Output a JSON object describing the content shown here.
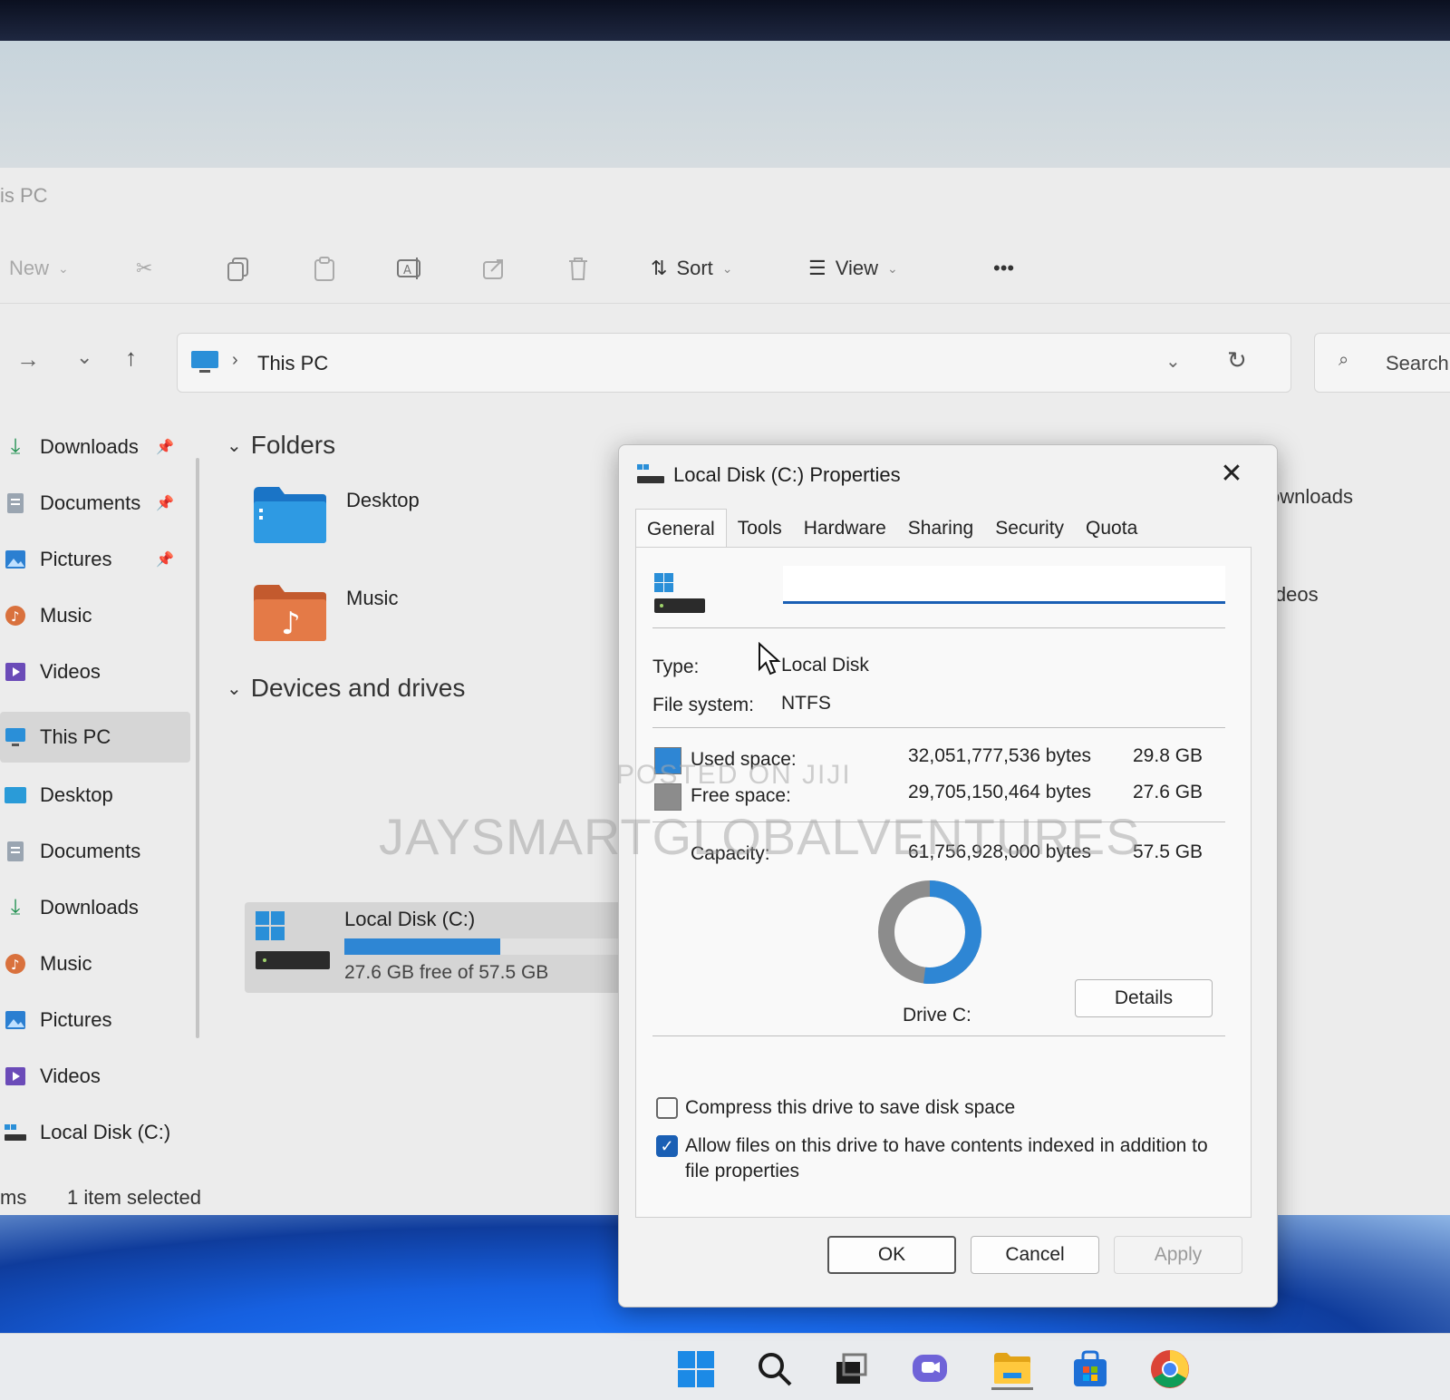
{
  "window": {
    "title": "is PC"
  },
  "commandbar": {
    "new_label": "New",
    "sort_label": "Sort",
    "view_label": "View",
    "more_label": "•••"
  },
  "address": {
    "path": "This PC",
    "search_placeholder": "Search"
  },
  "sidebar": {
    "items": [
      {
        "label": "Downloads",
        "icon": "download-icon",
        "pinned": true
      },
      {
        "label": "Documents",
        "icon": "document-icon",
        "pinned": true
      },
      {
        "label": "Pictures",
        "icon": "pictures-icon",
        "pinned": true
      },
      {
        "label": "Music",
        "icon": "music-icon"
      },
      {
        "label": "Videos",
        "icon": "videos-icon"
      },
      {
        "label": "This PC",
        "icon": "computer-icon",
        "selected": true
      },
      {
        "label": "Desktop",
        "icon": "desktop-icon"
      },
      {
        "label": "Documents",
        "icon": "document-icon"
      },
      {
        "label": "Downloads",
        "icon": "download-icon"
      },
      {
        "label": "Music",
        "icon": "music-icon"
      },
      {
        "label": "Pictures",
        "icon": "pictures-icon"
      },
      {
        "label": "Videos",
        "icon": "videos-icon"
      },
      {
        "label": "Local Disk (C:)",
        "icon": "drive-icon"
      }
    ]
  },
  "status": {
    "items_fragment": "ms",
    "selection": "1 item selected"
  },
  "content": {
    "folders_heading": "Folders",
    "folders": [
      {
        "label": "Desktop",
        "icon": "desktop-folder-icon"
      },
      {
        "label": "Music",
        "icon": "music-folder-icon"
      }
    ],
    "devices_heading": "Devices and drives",
    "drive": {
      "label": "Local Disk (C:)",
      "free_text": "27.6 GB free of 57.5 GB",
      "used_fraction": 0.52
    },
    "peek_right": [
      "ownloads",
      "ideos"
    ]
  },
  "dialog": {
    "title": "Local Disk (C:) Properties",
    "close_label": "✕",
    "tabs": [
      "General",
      "Tools",
      "Hardware",
      "Sharing",
      "Security",
      "Quota"
    ],
    "name_value": "",
    "type_label": "Type:",
    "type_value": "Local Disk",
    "fs_label": "File system:",
    "fs_value": "NTFS",
    "used_label": "Used space:",
    "used_bytes": "32,051,777,536 bytes",
    "used_gb": "29.8 GB",
    "free_label": "Free space:",
    "free_bytes": "29,705,150,464 bytes",
    "free_gb": "27.6 GB",
    "capacity_label": "Capacity:",
    "capacity_bytes": "61,756,928,000 bytes",
    "capacity_gb": "57.5 GB",
    "drive_label": "Drive C:",
    "details_label": "Details",
    "compress_label": "Compress this drive to save disk space",
    "compress_checked": false,
    "index_label_1": "Allow files on this drive to have contents indexed in addition to",
    "index_label_2": "file properties",
    "index_checked": true,
    "ok_label": "OK",
    "cancel_label": "Cancel",
    "apply_label": "Apply",
    "used_fraction": 0.519
  },
  "watermarks": {
    "small": "POSTED ON JIJI",
    "large": "JAYSMARTGLOBALVENTURES"
  },
  "colors": {
    "accent": "#1a5fb4",
    "used": "#2e86d4",
    "free": "#8c8c8c"
  }
}
